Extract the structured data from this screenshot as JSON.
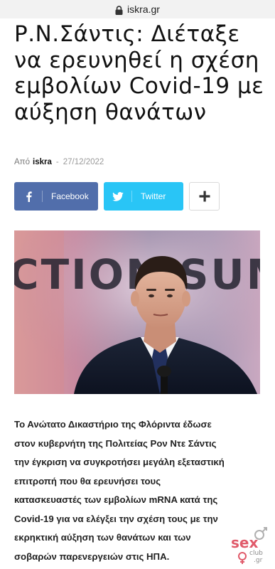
{
  "browser": {
    "domain": "iskra.gr",
    "lock_icon": "lock-icon"
  },
  "article": {
    "title": "Ρ.Ν.Σάντις: Διέταξε να ερευνηθεί η σχέση εμβολίων Covid-19 με αύξηση θανάτων",
    "meta": {
      "by_label": "Από",
      "author": "iskra",
      "separator": "-",
      "date": "27/12/2022"
    },
    "share": {
      "facebook_label": "Facebook",
      "twitter_label": "Twitter",
      "more_icon": "plus-icon"
    },
    "hero_background_text": "CTION SUM",
    "body_lines": [
      "Το Ανώτατο Δικαστήριο της Φλόριντα έδωσε",
      "στον κυβερνήτη της Πολιτείας Ρον Ντε Σάντις",
      "την έγκριση να συγκροτήσει μεγάλη εξεταστική",
      "επιτροπή που θα ερευνήσει τους",
      "κατασκευαστές των εμβολίων mRNA κατά της",
      "Covid-19 για να ελέγξει την σχέση τους με την",
      "εκρηκτική αύξηση των θανάτων και των",
      "σοβαρών παρενεργειών στις ΗΠΑ."
    ]
  },
  "watermark": {
    "brand": "sex",
    "sub": "club",
    "tld": ".gr"
  },
  "colors": {
    "facebook": "#516eab",
    "twitter": "#29c5f6"
  }
}
